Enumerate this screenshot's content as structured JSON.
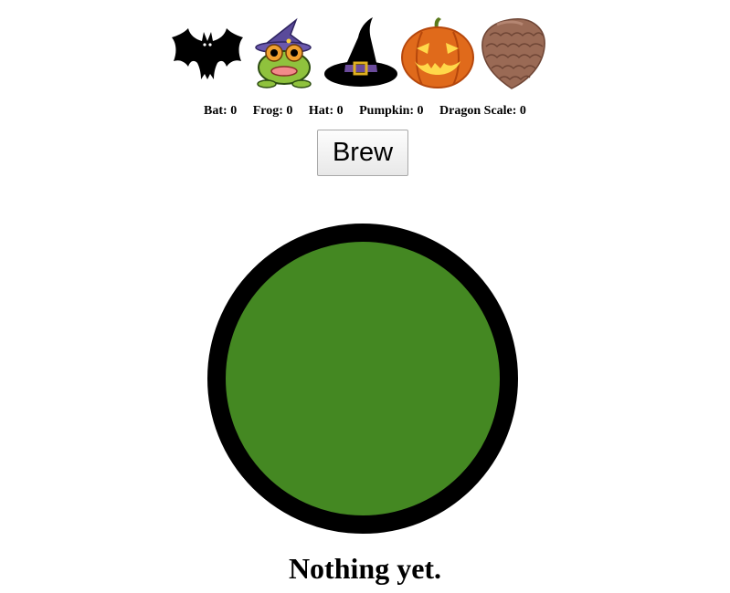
{
  "ingredients": [
    {
      "name": "Bat",
      "icon": "bat-icon",
      "count": "0"
    },
    {
      "name": "Frog",
      "icon": "frog-icon",
      "count": "0"
    },
    {
      "name": "Hat",
      "icon": "witch-hat-icon",
      "count": "0"
    },
    {
      "name": "Pumpkin",
      "icon": "pumpkin-icon",
      "count": "0"
    },
    {
      "name": "Dragon Scale",
      "icon": "dragon-scale-icon",
      "count": "0"
    }
  ],
  "counts_text": {
    "bat": "Bat: 0",
    "frog": "Frog: 0",
    "hat": "Hat: 0",
    "pumpkin": "Pumpkin: 0",
    "dragon_scale": "Dragon Scale: 0"
  },
  "brew_button": {
    "label": "Brew"
  },
  "cauldron": {
    "liquid_color": "#448822",
    "rim_color": "#000000"
  },
  "result": {
    "text": "Nothing yet."
  }
}
